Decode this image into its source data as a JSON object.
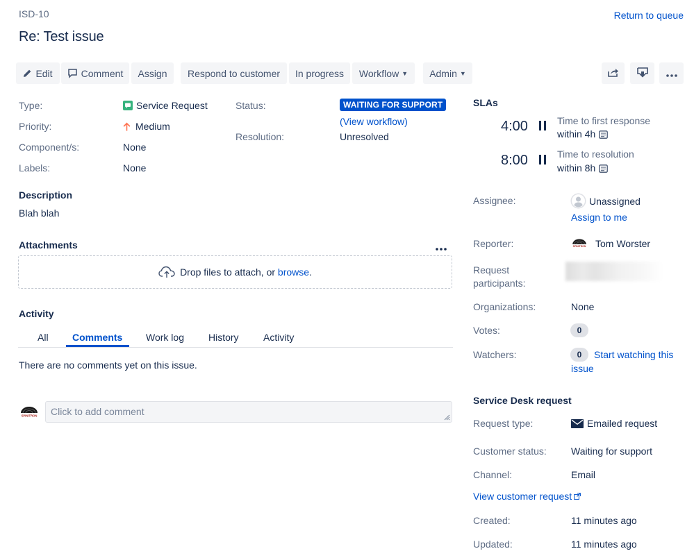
{
  "header": {
    "issue_key": "ISD-10",
    "title": "Re: Test issue",
    "return_link": "Return to queue"
  },
  "toolbar": {
    "edit": "Edit",
    "comment": "Comment",
    "assign": "Assign",
    "respond": "Respond to customer",
    "in_progress": "In progress",
    "workflow": "Workflow",
    "admin": "Admin"
  },
  "details": {
    "type_label": "Type:",
    "type_value": "Service Request",
    "priority_label": "Priority:",
    "priority_value": "Medium",
    "components_label": "Component/s:",
    "components_value": "None",
    "labels_label": "Labels:",
    "labels_value": "None",
    "status_label": "Status:",
    "status_value": "WAITING FOR SUPPORT",
    "view_workflow_open": "(",
    "view_workflow": "View workflow",
    "view_workflow_close": ")",
    "resolution_label": "Resolution:",
    "resolution_value": "Unresolved"
  },
  "description": {
    "title": "Description",
    "text": "Blah blah"
  },
  "attachments": {
    "title": "Attachments",
    "drop_text": "Drop files to attach, or ",
    "browse": "browse",
    "period": "."
  },
  "activity": {
    "title": "Activity",
    "tabs": [
      "All",
      "Comments",
      "Work log",
      "History",
      "Activity"
    ],
    "active_tab": "Comments",
    "empty_text": "There are no comments yet on this issue.",
    "comment_placeholder": "Click to add comment"
  },
  "slas": {
    "title": "SLAs",
    "items": [
      {
        "time": "4:00",
        "name": "Time to first response",
        "within": "within 4h"
      },
      {
        "time": "8:00",
        "name": "Time to resolution",
        "within": "within 8h"
      }
    ]
  },
  "people": {
    "assignee_label": "Assignee:",
    "assignee_value": "Unassigned",
    "assign_to_me": "Assign to me",
    "reporter_label": "Reporter:",
    "reporter_value": "Tom Worster",
    "participants_label_1": "Request",
    "participants_label_2": "participants:",
    "organizations_label": "Organizations:",
    "organizations_value": "None",
    "votes_label": "Votes:",
    "votes_count": "0",
    "watchers_label": "Watchers:",
    "watchers_count": "0",
    "start_watching_1": "Start watching this",
    "start_watching_2": "issue"
  },
  "service_desk": {
    "title": "Service Desk request",
    "request_type_label": "Request type:",
    "request_type_value": "Emailed request",
    "customer_status_label": "Customer status:",
    "customer_status_value": "Waiting for support",
    "channel_label": "Channel:",
    "channel_value": "Email",
    "view_customer_request": "View customer request",
    "created_label": "Created:",
    "created_value": "11 minutes ago",
    "updated_label": "Updated:",
    "updated_value": "11 minutes ago"
  },
  "avatar_text": "SPINITRON",
  "colors": {
    "link": "#0052cc",
    "status_lozenge": "#0052cc",
    "type_icon": "#36b37e",
    "priority_arrow": "#ff7452",
    "button_bg": "#f4f5f7"
  },
  "icons": [
    "pencil-icon",
    "comment-icon",
    "share-icon",
    "export-icon",
    "more-icon",
    "pause-icon",
    "calendar-icon",
    "upload-cloud-icon",
    "envelope-icon",
    "external-link-icon",
    "unassigned-avatar-icon"
  ]
}
